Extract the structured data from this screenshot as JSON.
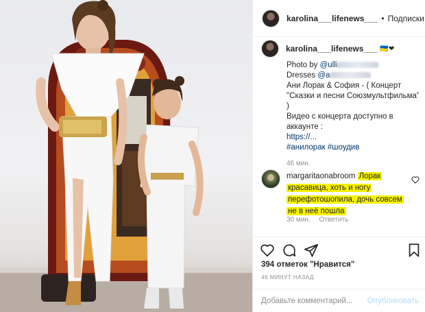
{
  "post": {
    "username": "karolina___lifenews___",
    "follow_label": "Подписки",
    "dot": "•"
  },
  "caption": {
    "username": "karolina___lifenews___",
    "emoji": "🇺🇦❤",
    "lines": [
      {
        "pre": "Photo by ",
        "link": "@ulli"
      },
      {
        "pre": "Dresses ",
        "link": "@a"
      },
      {
        "text": "Ани Лорак & София - ( Концерт"
      },
      {
        "text": "\"Сказки и песни Союзмультфильма\""
      },
      {
        "text": ")"
      },
      {
        "text": "Видео с концерта доступно в"
      },
      {
        "text": "аккаунте :"
      },
      {
        "text": "https://..."
      }
    ],
    "hashtags": "#анилорак #шоудив",
    "time": "46 мин."
  },
  "comment": {
    "username": "margaritaonabroom",
    "lines": [
      "Лорак",
      "красавица, хоть и ногу",
      "перефотошопила, дочь совсем",
      "не в неё пошла"
    ],
    "time": "30 мин.",
    "reply_label": "Ответить"
  },
  "actions": {
    "likes_count": "394 отметок",
    "likes_suffix": "\"Нравится\"",
    "timestamp": "46 МИНУТ НАЗАД"
  },
  "add_comment": {
    "placeholder": "Добавьте комментарий...",
    "publish_label": "Опубликовать"
  },
  "colors": {
    "highlight": "#f6f200",
    "link": "#00376b",
    "muted": "#8e8e8e",
    "publish_disabled": "#b2dffc"
  },
  "icons": [
    "heart-icon",
    "comment-icon",
    "share-icon",
    "bookmark-icon",
    "small-heart-icon"
  ]
}
